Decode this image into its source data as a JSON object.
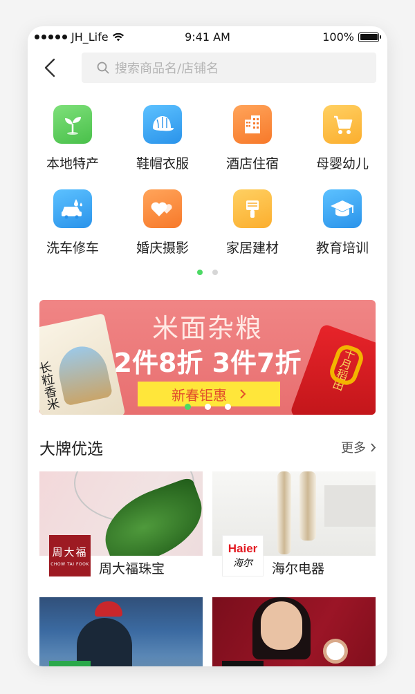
{
  "status": {
    "carrier": "JH_Life",
    "time": "9:41 AM",
    "battery": "100%"
  },
  "search": {
    "placeholder": "搜索商品名/店铺名"
  },
  "categories": [
    {
      "label": "本地特产",
      "icon": "sprout-icon",
      "color": "#5fcf5c"
    },
    {
      "label": "鞋帽衣服",
      "icon": "cap-icon",
      "color": "#39a9f5"
    },
    {
      "label": "酒店住宿",
      "icon": "building-icon",
      "color": "#fb8a3c"
    },
    {
      "label": "母婴幼儿",
      "icon": "stroller-icon",
      "color": "#fdbd3c"
    },
    {
      "label": "洗车修车",
      "icon": "car-wash-icon",
      "color": "#39a9f5"
    },
    {
      "label": "婚庆摄影",
      "icon": "hearts-icon",
      "color": "#fb8a3c"
    },
    {
      "label": "家居建材",
      "icon": "brush-icon",
      "color": "#fdbd3c"
    },
    {
      "label": "教育培训",
      "icon": "graduation-cap-icon",
      "color": "#39a9f5"
    }
  ],
  "banner": {
    "title": "米面杂粮",
    "subtitle": "2件8折 3件7折",
    "cta": "新春钜惠",
    "bag_left_text": "长粒香米",
    "bag_right_text": "十月稻田"
  },
  "section": {
    "title": "大牌优选",
    "more": "更多"
  },
  "brands": [
    {
      "name": "周大福珠宝",
      "logo_cn": "周大福",
      "logo_en": "CHOW TAI FOOK"
    },
    {
      "name": "海尔电器",
      "logo_en": "Haier",
      "logo_cn": "海尔"
    }
  ]
}
